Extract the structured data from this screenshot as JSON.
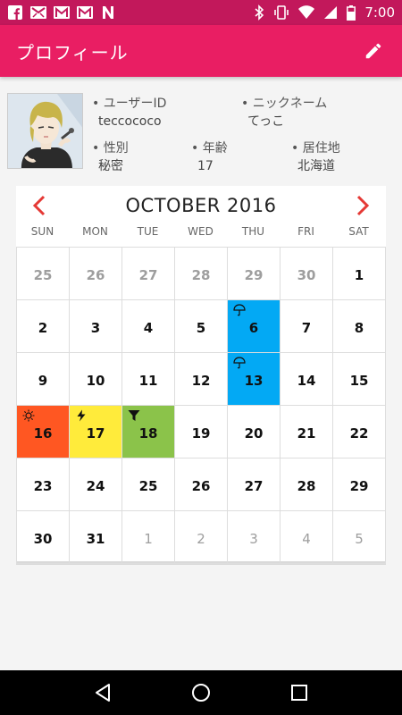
{
  "status_bar": {
    "time": "7:00",
    "icons_left": [
      "facebook-icon",
      "mail-icon",
      "gmail-icon",
      "gmail-icon",
      "news-icon"
    ],
    "icons_right": [
      "bluetooth-icon",
      "vibrate-icon",
      "wifi-icon",
      "signal-icon",
      "battery-icon"
    ]
  },
  "app_bar": {
    "title": "プロフィール",
    "action_icon": "edit-pencil-icon"
  },
  "profile": {
    "user_id_label": "ユーザーID",
    "user_id": "teccococo",
    "nickname_label": "ニックネーム",
    "nickname": "てっこ",
    "gender_label": "性別",
    "gender": "秘密",
    "age_label": "年齢",
    "age": "17",
    "residence_label": "居住地",
    "residence": "北海道"
  },
  "calendar": {
    "title": "OCTOBER 2016",
    "days_of_week": [
      "SUN",
      "MON",
      "TUE",
      "WED",
      "THU",
      "FRI",
      "SAT"
    ],
    "cells": [
      {
        "d": "25",
        "type": "prev"
      },
      {
        "d": "26",
        "type": "prev"
      },
      {
        "d": "27",
        "type": "prev"
      },
      {
        "d": "28",
        "type": "prev"
      },
      {
        "d": "29",
        "type": "prev"
      },
      {
        "d": "30",
        "type": "prev"
      },
      {
        "d": "1",
        "type": "cur"
      },
      {
        "d": "2",
        "type": "cur"
      },
      {
        "d": "3",
        "type": "cur"
      },
      {
        "d": "4",
        "type": "cur"
      },
      {
        "d": "5",
        "type": "cur"
      },
      {
        "d": "6",
        "type": "cur",
        "bg": "#03a9f4",
        "icon": "umbrella-icon"
      },
      {
        "d": "7",
        "type": "cur"
      },
      {
        "d": "8",
        "type": "cur"
      },
      {
        "d": "9",
        "type": "cur"
      },
      {
        "d": "10",
        "type": "cur"
      },
      {
        "d": "11",
        "type": "cur"
      },
      {
        "d": "12",
        "type": "cur"
      },
      {
        "d": "13",
        "type": "cur",
        "bg": "#03a9f4",
        "icon": "umbrella-icon"
      },
      {
        "d": "14",
        "type": "cur"
      },
      {
        "d": "15",
        "type": "cur"
      },
      {
        "d": "16",
        "type": "cur",
        "bg": "#ff5722",
        "icon": "sun-icon"
      },
      {
        "d": "17",
        "type": "cur",
        "bg": "#ffeb3b",
        "icon": "lightning-icon"
      },
      {
        "d": "18",
        "type": "cur",
        "bg": "#8bc34a",
        "icon": "filter-icon"
      },
      {
        "d": "19",
        "type": "cur"
      },
      {
        "d": "20",
        "type": "cur"
      },
      {
        "d": "21",
        "type": "cur"
      },
      {
        "d": "22",
        "type": "cur"
      },
      {
        "d": "23",
        "type": "cur"
      },
      {
        "d": "24",
        "type": "cur"
      },
      {
        "d": "25",
        "type": "cur"
      },
      {
        "d": "26",
        "type": "cur"
      },
      {
        "d": "27",
        "type": "cur"
      },
      {
        "d": "28",
        "type": "cur"
      },
      {
        "d": "29",
        "type": "cur"
      },
      {
        "d": "30",
        "type": "cur"
      },
      {
        "d": "31",
        "type": "cur"
      },
      {
        "d": "1",
        "type": "next"
      },
      {
        "d": "2",
        "type": "next"
      },
      {
        "d": "3",
        "type": "next"
      },
      {
        "d": "4",
        "type": "next"
      },
      {
        "d": "5",
        "type": "next"
      }
    ]
  },
  "colors": {
    "status_bar": "#c2185b",
    "app_bar": "#e91e63",
    "accent_red": "#e53935",
    "rain_blue": "#03a9f4",
    "hot_orange": "#ff5722",
    "yellow": "#ffeb3b",
    "green": "#8bc34a"
  },
  "nav_bar": {
    "buttons": [
      "back-icon",
      "home-icon",
      "recents-icon"
    ]
  }
}
